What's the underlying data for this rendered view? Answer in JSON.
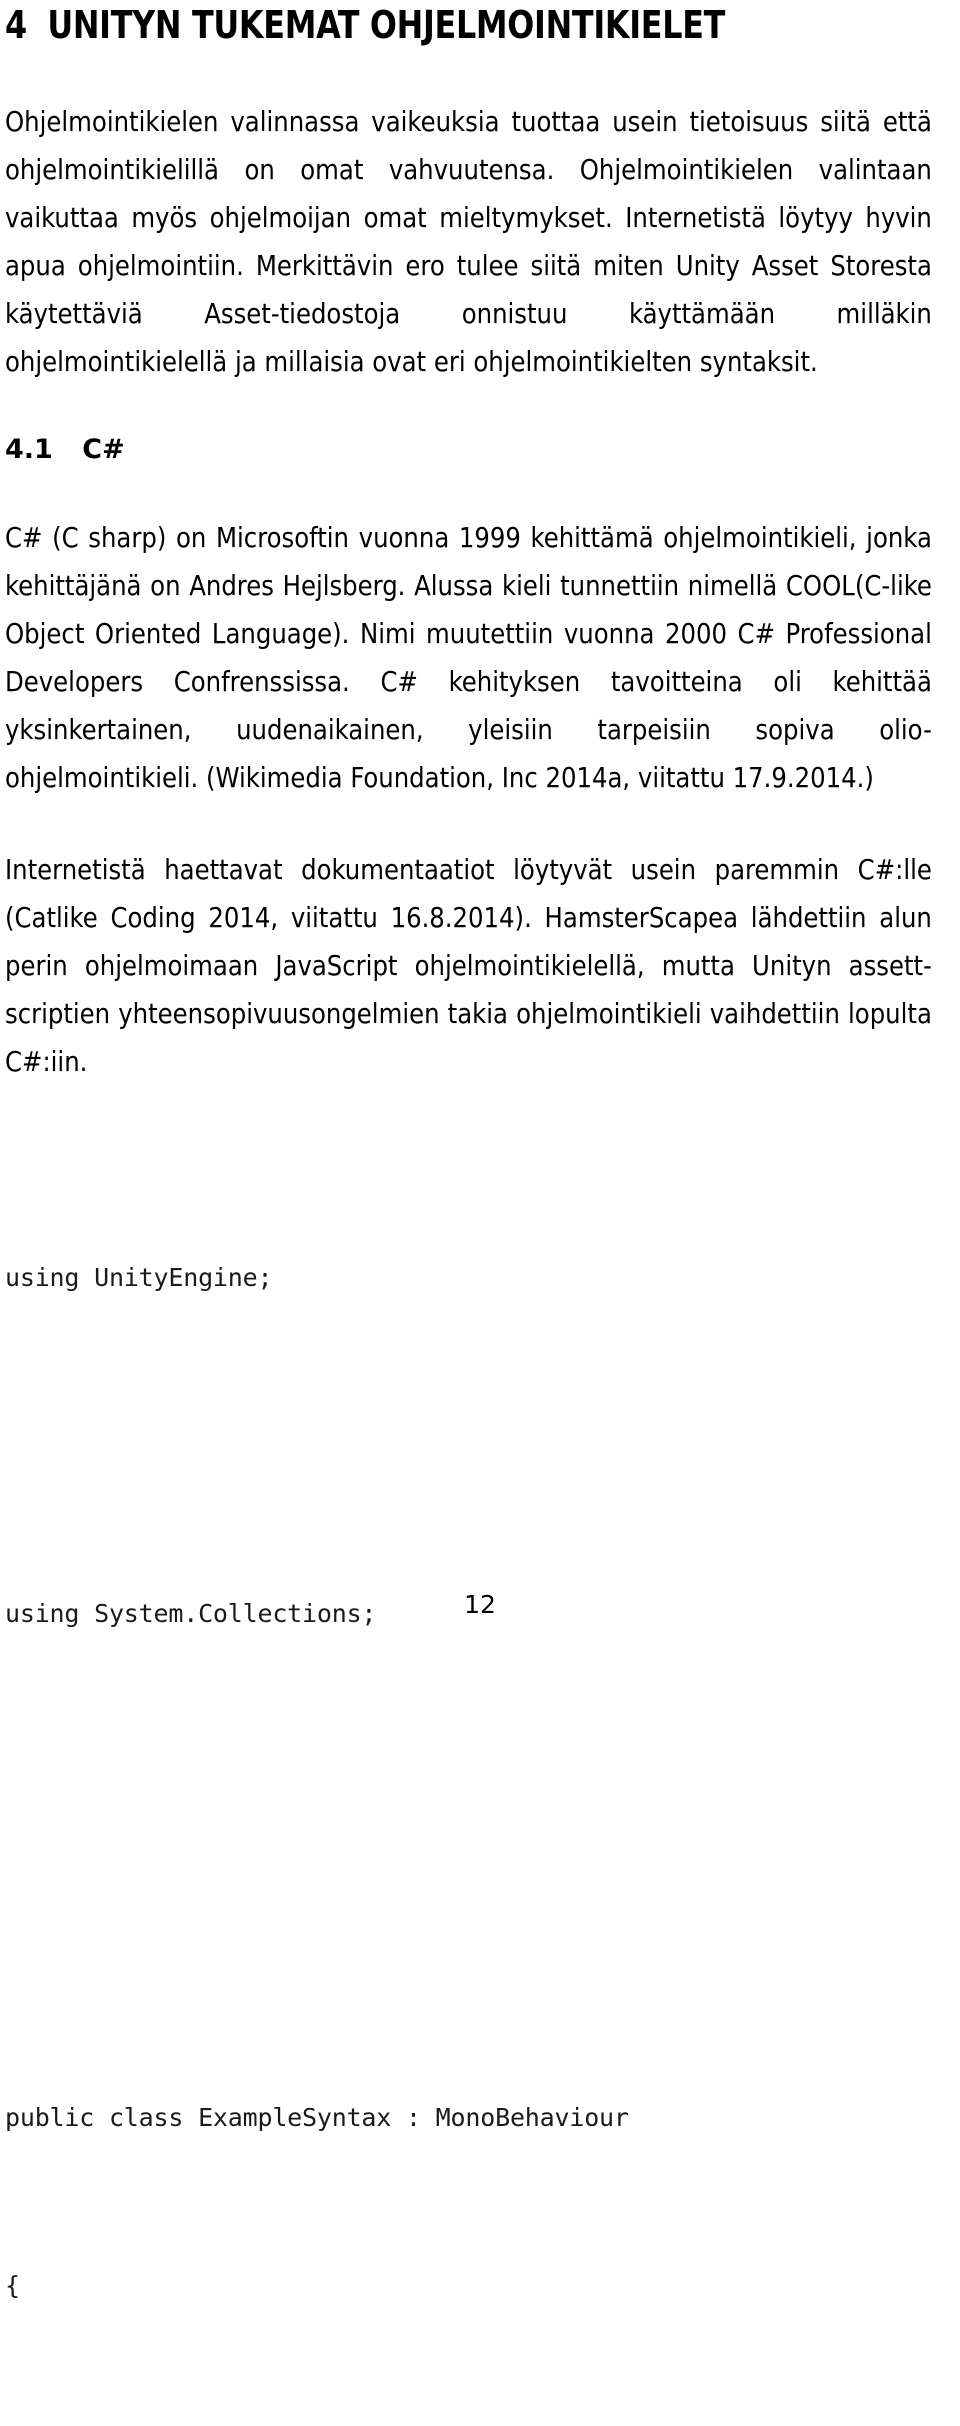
{
  "document": {
    "language": "fi",
    "page_number": "12",
    "text_color": "#000000",
    "background_color": "#ffffff"
  },
  "chapter": {
    "number": "4",
    "title": "UNITYN TUKEMAT OHJELMOINTIKIELET"
  },
  "intro_paragraph": "Ohjelmointikielen valinnassa vaikeuksia tuottaa usein tietoisuus siitä että ohjelmointikielillä on omat vahvuutensa. Ohjelmointikielen valintaan vaikuttaa myös ohjelmoijan omat mieltymykset. Internetistä löytyy hyvin apua ohjelmointiin. Merkittävin ero tulee siitä miten Unity Asset Storesta käytettäviä Asset-tiedostoja onnistuu käyttämään milläkin ohjelmointikielellä ja millaisia ovat eri ohjelmointikielten syntaksit.",
  "section": {
    "number": "4.1",
    "title": "C#"
  },
  "paragraphs": [
    "C# (C sharp) on Microsoftin vuonna 1999 kehittämä ohjelmointikieli, jonka kehittäjänä on Andres Hejlsberg. Alussa kieli tunnettiin nimellä COOL(C-like Object Oriented Language). Nimi muutettiin vuonna 2000 C# Professional Developers Confrenssissa. C# kehityksen tavoitteina oli kehittää yksinkertainen, uudenaikainen, yleisiin tarpeisiin sopiva olio-ohjelmointikieli. (Wikimedia Foundation, Inc 2014a, viitattu 17.9.2014.)",
    "Internetistä haettavat dokumentaatiot löytyvät usein paremmin C#:lle (Catlike Coding 2014, viitattu 16.8.2014). HamsterScapea lähdettiin alun perin ohjelmoimaan JavaScript ohjelmointikielellä, mutta Unityn assett-scriptien yhteensopivuusongelmien takia ohjelmointikieli vaihdettiin lopulta C#:iin."
  ],
  "code": {
    "language": "csharp",
    "lines": [
      "using UnityEngine;",
      "",
      "using System.Collections;",
      "",
      "",
      "public class ExampleSyntax : MonoBehaviour",
      "{"
    ]
  }
}
